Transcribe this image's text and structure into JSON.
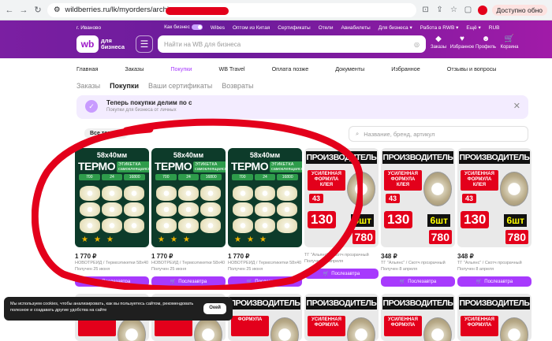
{
  "browser": {
    "url": "wildberries.ru/lk/myorders/archive",
    "availability": "Доступно обно"
  },
  "wb": {
    "location": "г. Иваново",
    "topbar": [
      "Как бизнес",
      "Wibes",
      "Оптом из Китая",
      "Сертификаты",
      "Отели",
      "Авиабилеты",
      "Для бизнеса ▾",
      "Работа в RWB ▾",
      "Ещё ▾"
    ],
    "currency": "RUB",
    "logo_wb": "wb",
    "logo_text": "для бизнеса",
    "search_placeholder": "Найти на WB для бизнеса",
    "icons": [
      {
        "name": "Заказы",
        "icon": "◆"
      },
      {
        "name": "Избранное",
        "icon": "♥"
      },
      {
        "name": "Профиль",
        "icon": "☻"
      },
      {
        "name": "Корзина",
        "icon": "🛒"
      }
    ],
    "menu": [
      "Главная",
      "Заказы",
      "Покупки",
      "WB Travel",
      "Оплата позже",
      "Документы",
      "Избранное",
      "Отзывы и вопросы"
    ],
    "subtabs": [
      "Заказы",
      "Покупки",
      "Ваши сертификаты",
      "Возвраты"
    ],
    "banner_title": "Теперь покупки делим по с",
    "banner_sub": "Покупки для бизнеса от личных",
    "filter_all": "Все товары",
    "filter_search": "Название, бренд, артикул"
  },
  "cards": [
    {
      "type": "thermo",
      "price": "1 770 ₽",
      "desc": "НОВОТРЕЙД / Термоэтикетки 58х40",
      "recv": "Получен 25 июня",
      "btn": "Послезавтра",
      "size": "58x40мм",
      "title": "ТЕРМО",
      "label": "ЭТИКЕТКА самоклеящаяся",
      "chips": [
        "700",
        "24",
        "16800"
      ]
    },
    {
      "type": "thermo",
      "price": "1 770 ₽",
      "desc": "НОВОТРЕЙД / Термоэтикетки 58х40",
      "recv": "Получен 25 июня",
      "btn": "Послезавтра",
      "size": "58x40мм",
      "title": "ТЕРМО",
      "label": "ЭТИКЕТКА самоклеящаяся",
      "chips": [
        "700",
        "24",
        "16800"
      ]
    },
    {
      "type": "thermo",
      "price": "1 770 ₽",
      "desc": "НОВОТРЕЙД / Термоэтикетки 58х40",
      "recv": "Получен 25 июня",
      "btn": "Послезавтра",
      "size": "58x40мм",
      "title": "ТЕРМО",
      "label": "ЭТИКЕТКА самоклеящаяся",
      "chips": [
        "700",
        "24",
        "16800"
      ]
    },
    {
      "type": "prod",
      "price": "",
      "desc": "ТГ \"Альянс\" / Скотч прозрачный",
      "recv": "Получен 22 апреля",
      "btn": "Послезавтра",
      "head": "ПРОИЗВОДИТЕЛЬ",
      "formula": "УСИЛЕННАЯ ФОРМУЛА КЛЕЯ",
      "num": "43",
      "big": "130",
      "sht": "6шт",
      "pr": "780"
    },
    {
      "type": "prod",
      "price": "348 ₽",
      "desc": "ТГ \"Альянс\" / Скотч прозрачный",
      "recv": "Получен 8 апреля",
      "btn": "Послезавтра",
      "head": "ПРОИЗВОДИТЕЛЬ",
      "formula": "УСИЛЕННАЯ ФОРМУЛА КЛЕЯ",
      "num": "43",
      "big": "130",
      "sht": "6шт",
      "pr": "780"
    },
    {
      "type": "prod",
      "price": "348 ₽",
      "desc": "ТГ \"Альянс\" / Скотч прозрачный",
      "recv": "Получен 8 апреля",
      "btn": "Послезавтра",
      "head": "ПРОИЗВОДИТЕЛЬ",
      "formula": "УСИЛЕННАЯ ФОРМУЛА КЛЕЯ",
      "num": "43",
      "big": "130",
      "sht": "6шт",
      "pr": "780"
    }
  ],
  "row2": [
    {
      "head": "ПРОИЗВОДИТЕЛЬ",
      "formula": "ФОРМУЛА"
    },
    {
      "head": "ПРОИЗВОДИТЕЛЬ",
      "formula": "ФОРМУЛА"
    },
    {
      "head": "ПРОИЗВОДИТЕЛЬ",
      "formula": "ФОРМУЛА"
    },
    {
      "head": "ПРОИЗВОДИТЕЛЬ",
      "formula": "УСИЛЕННАЯ ФОРМУЛА"
    },
    {
      "head": "ПРОИЗВОДИТЕЛЬ",
      "formula": "УСИЛЕННАЯ ФОРМУЛА"
    },
    {
      "head": "ПРОИЗВОДИТЕЛЬ",
      "formula": "УСИЛЕННАЯ ФОРМУЛА"
    }
  ],
  "cookie": {
    "text": "Мы используем cookies, чтобы анализировать, как вы пользуетесь сайтом, рекомендовать полезное и создавать другие удобства на сайте",
    "ok": "Окей"
  },
  "colors": {
    "accent": "#a73afd",
    "annotation": "#e3001b"
  }
}
